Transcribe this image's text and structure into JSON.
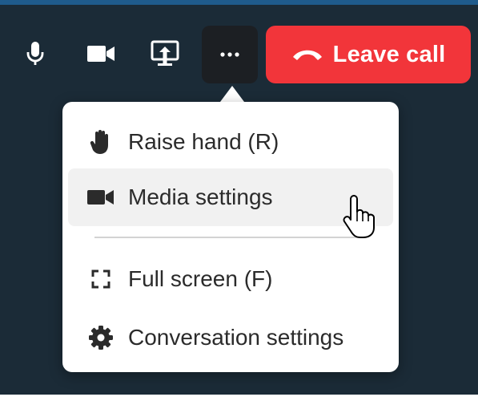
{
  "toolbar": {
    "leave_label": "Leave call",
    "leave_color": "#f2353a",
    "background_color": "#1b2b37",
    "mic_icon": "microphone-icon",
    "camera_icon": "video-camera-icon",
    "share_icon": "screen-share-icon",
    "more_icon": "more-options-icon",
    "leave_icon": "phone-hangup-icon"
  },
  "menu": {
    "items": [
      {
        "label": "Raise hand (R)",
        "icon": "raised-hand-icon"
      },
      {
        "label": "Media settings",
        "icon": "video-camera-icon",
        "hovered": true
      },
      {
        "label": "Full screen (F)",
        "icon": "fullscreen-icon"
      },
      {
        "label": "Conversation settings",
        "icon": "gear-icon"
      }
    ]
  },
  "cursor": {
    "icon": "hand-pointer-icon"
  }
}
